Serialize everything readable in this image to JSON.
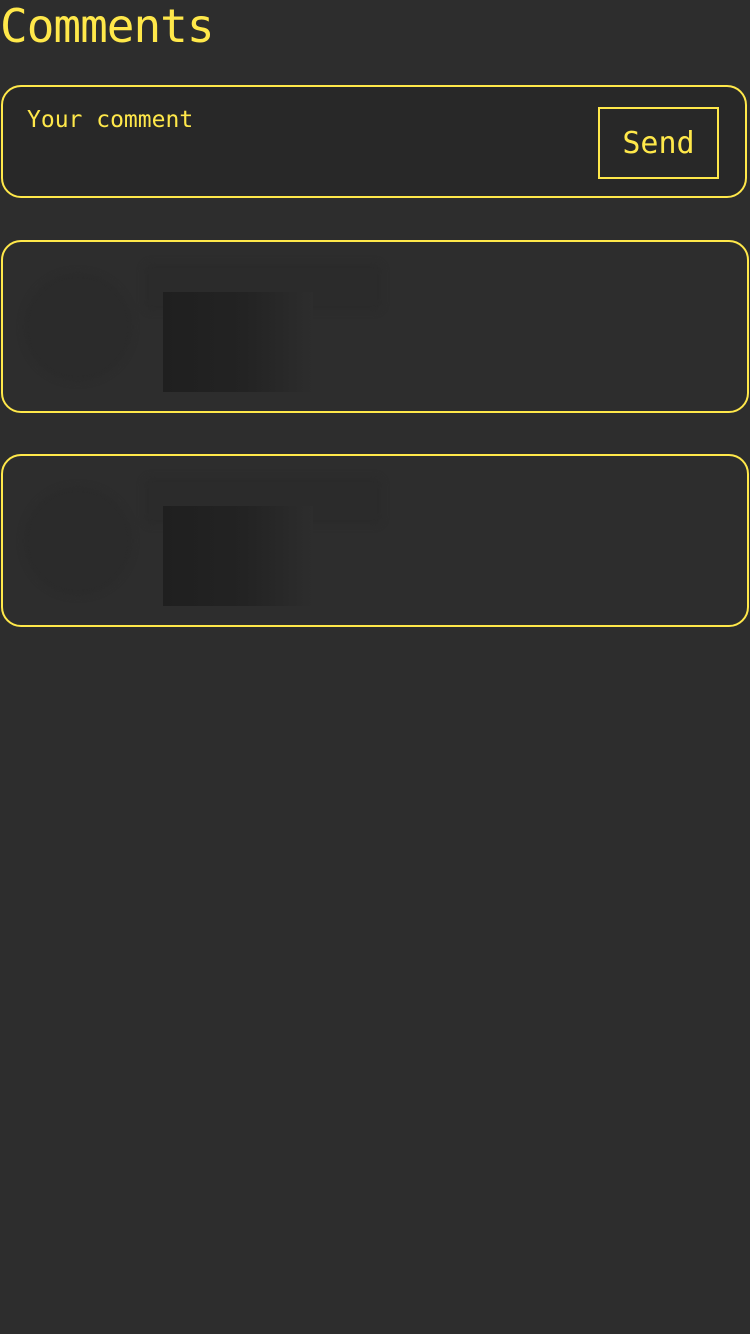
{
  "header": {
    "title": "Comments"
  },
  "comment_form": {
    "placeholder": "Your comment",
    "value": "",
    "send_label": "Send"
  },
  "comments": [
    {
      "state": "loading"
    },
    {
      "state": "loading"
    }
  ],
  "colors": {
    "background": "#2d2d2d",
    "accent": "#ffe84a",
    "input_background": "#282828"
  }
}
